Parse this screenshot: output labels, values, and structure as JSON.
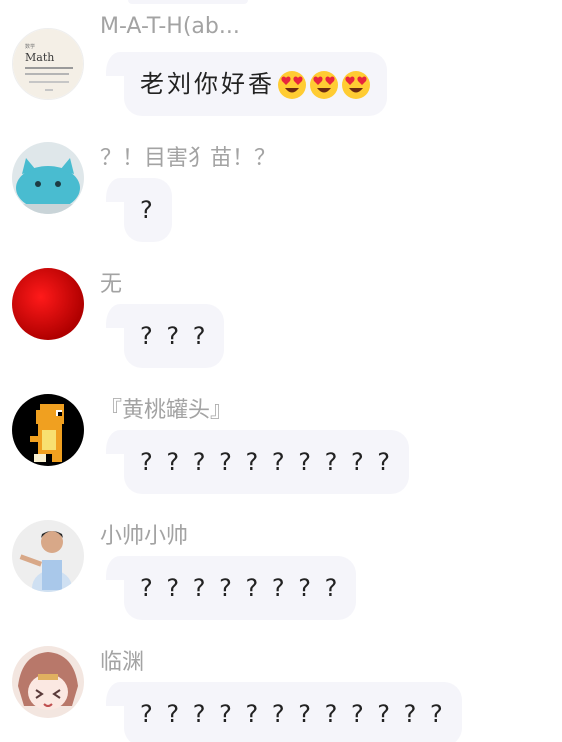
{
  "messages": [
    {
      "sender": "M-A-T-H(ab...",
      "text": "老刘你好香",
      "emoji": [
        "heart-eyes",
        "heart-eyes",
        "heart-eyes"
      ],
      "avatar": "math-card-icon"
    },
    {
      "sender": "？！目害犭苗！？",
      "text": "?",
      "avatar": "blue-cat-icon"
    },
    {
      "sender": "无",
      "text": "? ? ?",
      "avatar": "red-ball-icon"
    },
    {
      "sender": "『黄桃罐头』",
      "text": "? ? ? ? ? ? ? ? ? ?",
      "avatar": "pixel-charmander-icon"
    },
    {
      "sender": "小帅小帅",
      "text": "? ? ? ? ? ? ? ?",
      "avatar": "man-photo-icon"
    },
    {
      "sender": "临渊",
      "text": "? ? ? ? ? ? ? ? ? ? ? ?",
      "avatar": "anime-girl-icon"
    }
  ],
  "avatar_card": {
    "label": "Math",
    "small": "数学"
  }
}
